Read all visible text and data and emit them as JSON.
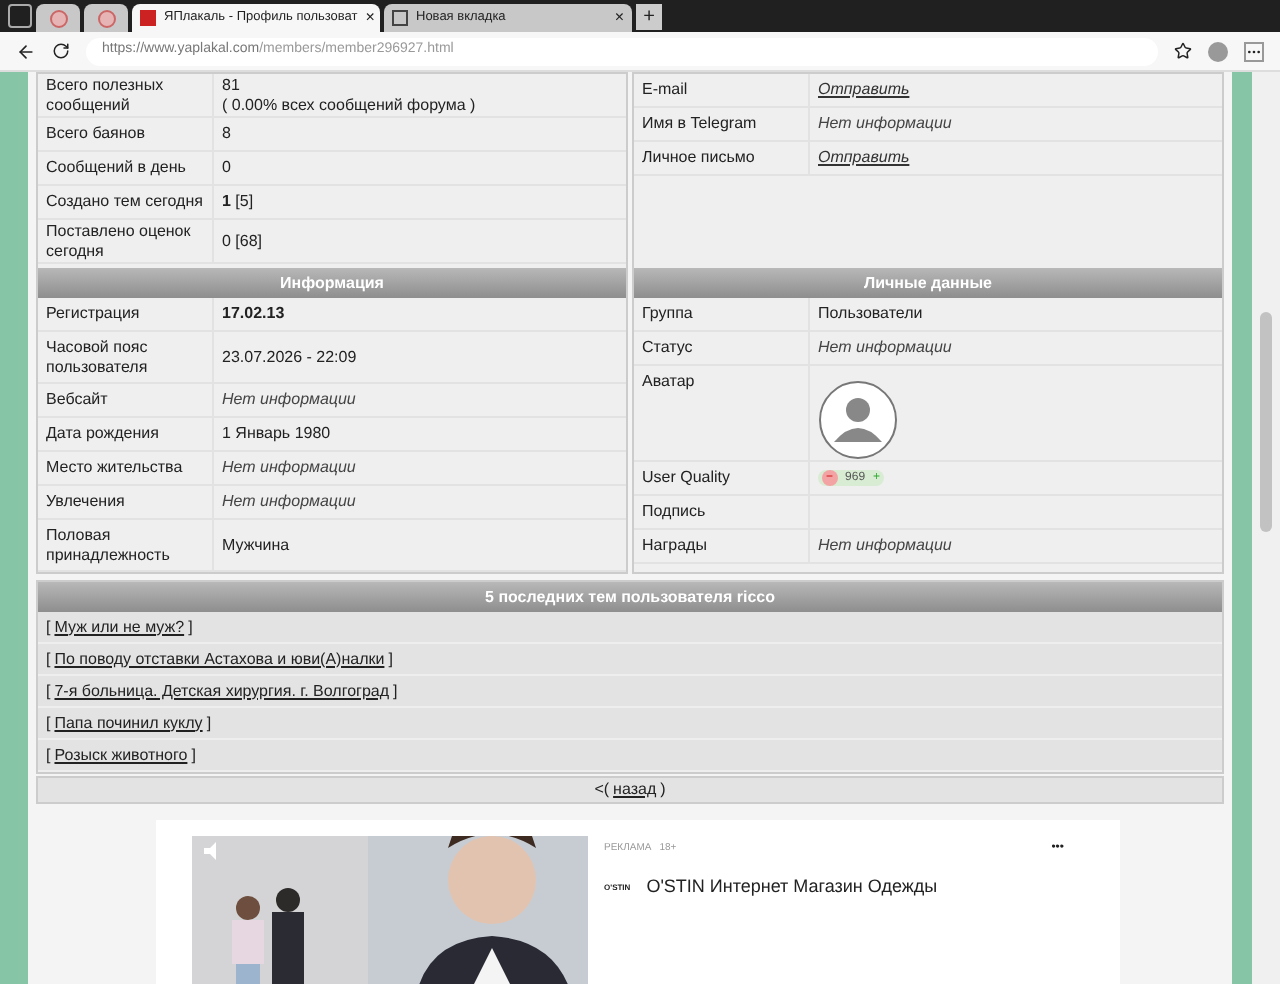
{
  "browser": {
    "tabs": [
      {
        "kind": "pinned",
        "selected": false
      },
      {
        "kind": "pinned",
        "selected": false
      },
      {
        "kind": "page",
        "title": "ЯПлакаль - Профиль пользоват",
        "close": "×",
        "selected": true
      },
      {
        "kind": "page",
        "title": "Новая вкладка",
        "close": "×",
        "selected": false
      }
    ],
    "new_tab": "+",
    "url_host": "https://www.yaplakal.com",
    "url_path": "/members/member296927.html"
  },
  "stats": {
    "rows": [
      {
        "label": "Всего полезных сообщений",
        "value": "81",
        "note": "( 0.00% всех сообщений форума )"
      },
      {
        "label": "Всего баянов",
        "value": "8"
      },
      {
        "label": "Сообщений в день",
        "value": "0"
      },
      {
        "label": "Создано тем сегодня",
        "value": "**1** [5]"
      },
      {
        "label": "Поставлено оценок сегодня",
        "value": "0 [68]"
      }
    ]
  },
  "contacts": {
    "rows": [
      {
        "label": "E-mail",
        "value": "Отправить",
        "kind": "link"
      },
      {
        "label": "Имя в Telegram",
        "value": "Нет информации",
        "kind": "none"
      },
      {
        "label": "Личное письмо",
        "value": "Отправить",
        "kind": "link"
      }
    ]
  },
  "info": {
    "title": "Информация",
    "rows": [
      {
        "label": "Регистрация",
        "value": "17.02.13",
        "kind": "bold"
      },
      {
        "label": "Часовой пояс пользователя",
        "value": "23.07.2026 - 22:09",
        "kind": "text"
      },
      {
        "label": "Вебсайт",
        "value": "Нет информации",
        "kind": "none"
      },
      {
        "label": "Дата рождения",
        "value": "1 Январь 1980",
        "kind": "text"
      },
      {
        "label": "Место жительства",
        "value": "Нет информации",
        "kind": "none"
      },
      {
        "label": "Увлечения",
        "value": "Нет информации",
        "kind": "none"
      },
      {
        "label": "Половая принадлежность",
        "value": "Мужчина",
        "kind": "text"
      }
    ]
  },
  "personal": {
    "title": "Личные данные",
    "rows": [
      {
        "label": "Группа",
        "kind": "text",
        "value": "Пользователи"
      },
      {
        "label": "Статус",
        "kind": "none",
        "value": "Нет информации"
      },
      {
        "label": "Аватар",
        "kind": "avatar"
      },
      {
        "label": "User Quality",
        "kind": "quality",
        "minus": "−",
        "value": "969",
        "plus": "+"
      },
      {
        "label": "Подпись",
        "kind": "empty"
      },
      {
        "label": "Награды",
        "kind": "none",
        "value": "Нет информации"
      }
    ]
  },
  "topics": {
    "title": "5 последних тем пользователя ricco",
    "items": [
      {
        "open": "[",
        "title": "Муж или не муж?",
        "close": "]"
      },
      {
        "open": "[",
        "title": "По поводу отставки Астахова и юви(А)налки",
        "close": "]"
      },
      {
        "open": "[",
        "title": "7-я больница. Детская хирургия. г. Волгоград",
        "close": "]"
      },
      {
        "open": "[",
        "title": "Папа починил куклу",
        "close": "]"
      },
      {
        "open": "[",
        "title": "Розыск животного",
        "close": "]"
      }
    ]
  },
  "back": {
    "prefix": "<(",
    "link": "назад",
    "suffix": ")"
  },
  "ad": {
    "label": "РЕКЛАМА",
    "age": "18+",
    "logo": "O'STIN",
    "title": "O'STIN Интернет Магазин Одежды",
    "menu": "•••"
  }
}
